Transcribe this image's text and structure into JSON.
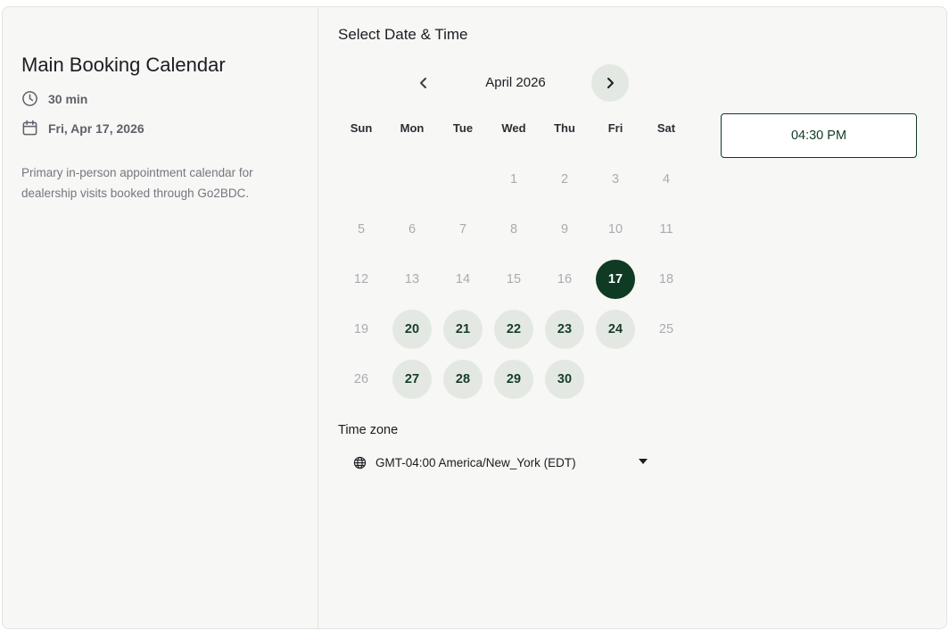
{
  "event": {
    "title": "Main Booking Calendar",
    "duration": "30 min",
    "selected_date": "Fri, Apr 17, 2026",
    "description": "Primary in-person appointment calendar for dealership visits booked through Go2BDC.",
    "duration_icon": "clock-icon",
    "date_icon": "calendar-icon"
  },
  "booking": {
    "section_title": "Select Date & Time",
    "month_label": "April 2026",
    "prev_icon": "chevron-left-icon",
    "next_icon": "chevron-right-icon",
    "weekdays": [
      "Sun",
      "Mon",
      "Tue",
      "Wed",
      "Thu",
      "Fri",
      "Sat"
    ],
    "days": [
      {
        "day": "1",
        "state": "disabled"
      },
      {
        "day": "2",
        "state": "disabled"
      },
      {
        "day": "3",
        "state": "disabled"
      },
      {
        "day": "4",
        "state": "disabled"
      },
      {
        "day": "5",
        "state": "disabled"
      },
      {
        "day": "6",
        "state": "disabled"
      },
      {
        "day": "7",
        "state": "disabled"
      },
      {
        "day": "8",
        "state": "disabled"
      },
      {
        "day": "9",
        "state": "disabled"
      },
      {
        "day": "10",
        "state": "disabled"
      },
      {
        "day": "11",
        "state": "disabled"
      },
      {
        "day": "12",
        "state": "disabled"
      },
      {
        "day": "13",
        "state": "disabled"
      },
      {
        "day": "14",
        "state": "disabled"
      },
      {
        "day": "15",
        "state": "disabled"
      },
      {
        "day": "16",
        "state": "disabled"
      },
      {
        "day": "17",
        "state": "selected"
      },
      {
        "day": "18",
        "state": "disabled"
      },
      {
        "day": "19",
        "state": "disabled"
      },
      {
        "day": "20",
        "state": "available"
      },
      {
        "day": "21",
        "state": "available"
      },
      {
        "day": "22",
        "state": "available"
      },
      {
        "day": "23",
        "state": "available"
      },
      {
        "day": "24",
        "state": "available"
      },
      {
        "day": "25",
        "state": "disabled"
      },
      {
        "day": "26",
        "state": "disabled"
      },
      {
        "day": "27",
        "state": "available"
      },
      {
        "day": "28",
        "state": "available"
      },
      {
        "day": "29",
        "state": "available"
      },
      {
        "day": "30",
        "state": "available"
      }
    ],
    "time_slots": [
      "04:30 PM"
    ],
    "timezone_label": "Time zone",
    "timezone_value": "GMT-04:00 America/New_York (EDT)",
    "timezone_icon": "globe-icon"
  },
  "colors": {
    "accent": "#0f3a23",
    "available_bg": "#e4e8e3",
    "panel_bg": "#f7f7f5",
    "disabled_text": "#a9acb0"
  }
}
